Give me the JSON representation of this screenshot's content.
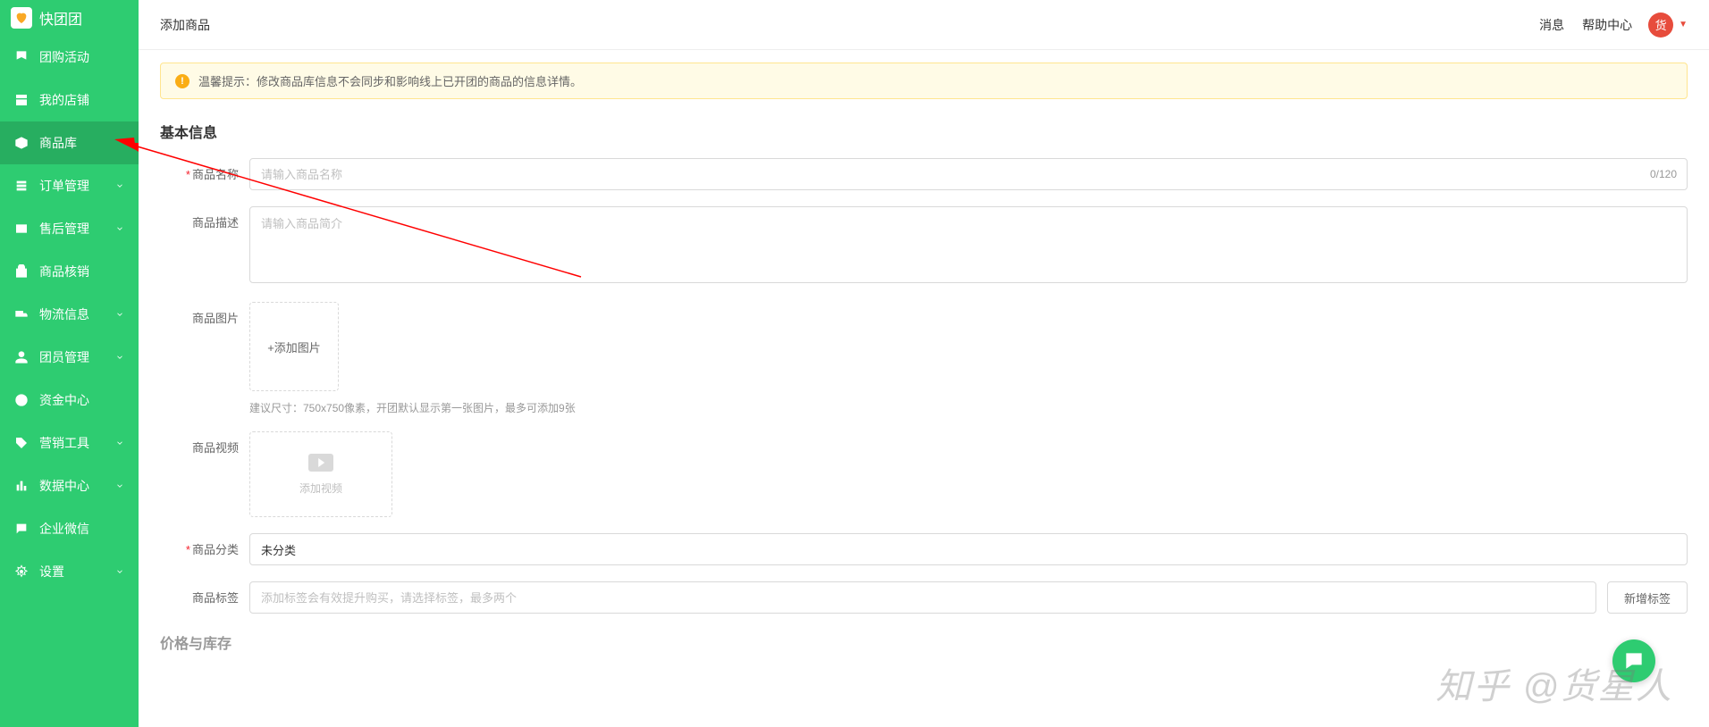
{
  "brand": "快团团",
  "sidebar": {
    "items": [
      {
        "label": "团购活动",
        "expandable": false
      },
      {
        "label": "我的店铺",
        "expandable": false
      },
      {
        "label": "商品库",
        "expandable": false,
        "active": true
      },
      {
        "label": "订单管理",
        "expandable": true
      },
      {
        "label": "售后管理",
        "expandable": true
      },
      {
        "label": "商品核销",
        "expandable": false
      },
      {
        "label": "物流信息",
        "expandable": true
      },
      {
        "label": "团员管理",
        "expandable": true
      },
      {
        "label": "资金中心",
        "expandable": false
      },
      {
        "label": "营销工具",
        "expandable": true
      },
      {
        "label": "数据中心",
        "expandable": true
      },
      {
        "label": "企业微信",
        "expandable": false
      },
      {
        "label": "设置",
        "expandable": true
      }
    ]
  },
  "topbar": {
    "title": "添加商品",
    "links": {
      "messages": "消息",
      "help": "帮助中心"
    },
    "avatar_text": "货"
  },
  "alert": {
    "prefix": "温馨提示：",
    "text": "修改商品库信息不会同步和影响线上已开团的商品的信息详情。"
  },
  "sections": {
    "basic": "基本信息",
    "price": "价格与库存"
  },
  "form": {
    "name": {
      "label": "商品名称",
      "placeholder": "请输入商品名称",
      "counter": "0/120"
    },
    "desc": {
      "label": "商品描述",
      "placeholder": "请输入商品简介"
    },
    "image": {
      "label": "商品图片",
      "button": "+添加图片",
      "hint": "建议尺寸：750x750像素，开团默认显示第一张图片，最多可添加9张"
    },
    "video": {
      "label": "商品视频",
      "button": "添加视频"
    },
    "category": {
      "label": "商品分类",
      "value": "未分类"
    },
    "tags": {
      "label": "商品标签",
      "placeholder": "添加标签会有效提升购买，请选择标签，最多两个",
      "add_button": "新增标签"
    }
  },
  "watermark": "知乎 @货星人"
}
